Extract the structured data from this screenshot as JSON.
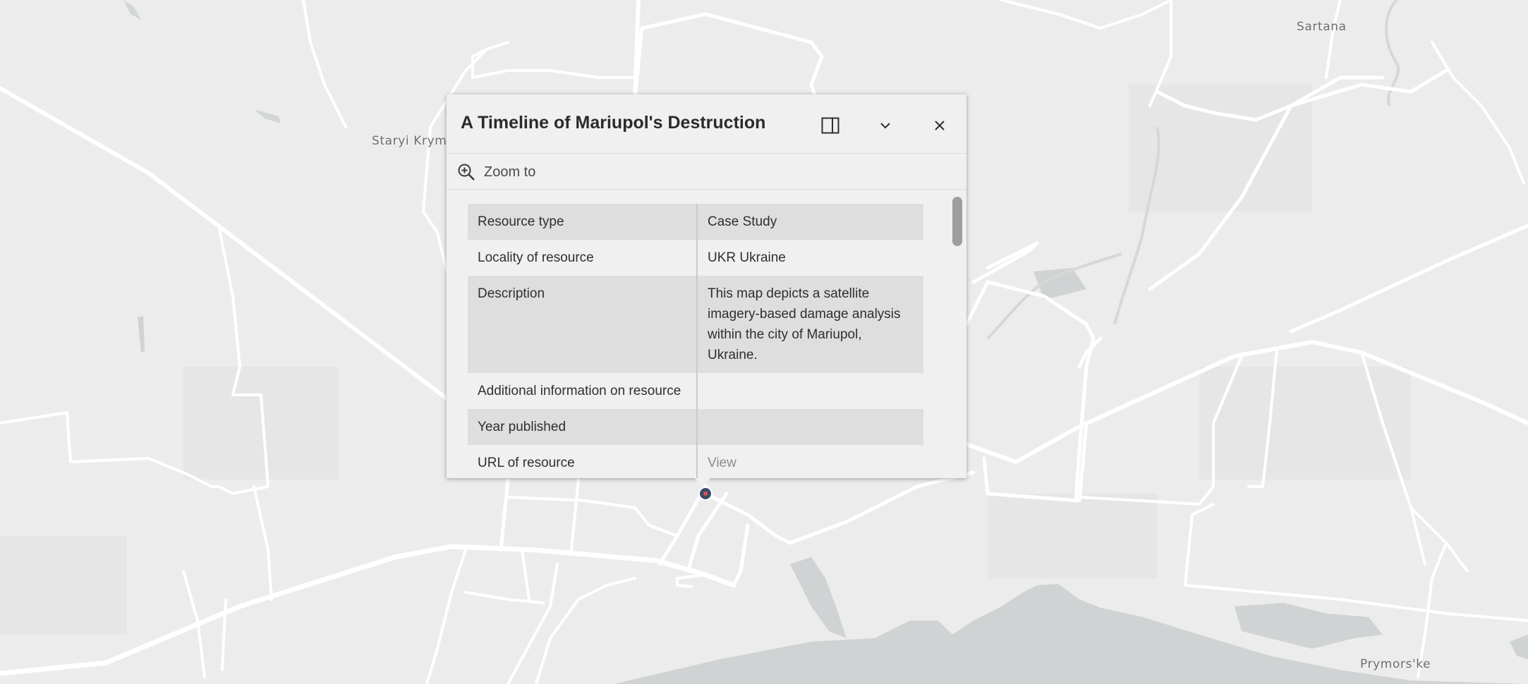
{
  "map": {
    "places": [
      {
        "name": "Sartana"
      },
      {
        "name": "Staryi Krym"
      },
      {
        "name": "Prymors'ke"
      }
    ],
    "marker_color": "#3c4a6b",
    "water_color": "#d0d3d3"
  },
  "popup": {
    "title": "A Timeline of Mariupol's Destruction",
    "actions": {
      "dock_icon": "dock-side-icon",
      "collapse_icon": "chevron-down-icon",
      "close_icon": "close-icon",
      "zoom_icon": "zoom-in-icon",
      "zoom_label": "Zoom to"
    },
    "fields": [
      {
        "label": "Resource type",
        "value": "Case Study"
      },
      {
        "label": "Locality of resource",
        "value": "UKR Ukraine"
      },
      {
        "label": "Description",
        "value": "This map depicts a satellite imagery-based damage analysis within the city of Mariupol, Ukraine."
      },
      {
        "label": "Additional information on resource",
        "value": ""
      },
      {
        "label": "Year published",
        "value": ""
      },
      {
        "label": "URL of resource",
        "value": "View"
      }
    ]
  }
}
